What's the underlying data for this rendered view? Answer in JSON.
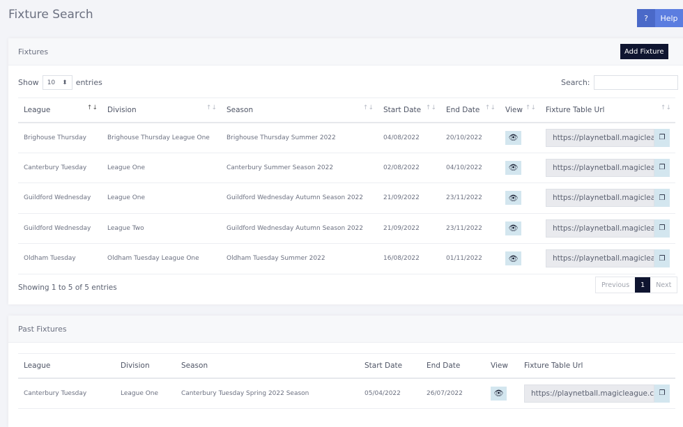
{
  "page": {
    "title": "Fixture Search",
    "help_icon": "?",
    "help_label": "Help"
  },
  "fixtures": {
    "title": "Fixtures",
    "add_label": "Add Fixture",
    "show_label": "Show",
    "entries_value": "10",
    "entries_label": "entries",
    "search_label": "Search:",
    "columns": [
      "League",
      "Division",
      "Season",
      "Start Date",
      "End Date",
      "View",
      "Fixture Table Url"
    ],
    "rows": [
      [
        "Brighouse Thursday",
        "Brighouse Thursday League One",
        "Brighouse Thursday Summer 2022",
        "04/08/2022",
        "20/10/2022",
        "https://playnetball.magicleag"
      ],
      [
        "Canterbury Tuesday",
        "League One",
        "Canterbury Summer Season 2022",
        "02/08/2022",
        "04/10/2022",
        "https://playnetball.magicleag"
      ],
      [
        "Guildford Wednesday",
        "League One",
        "Guildford Wednesday Autumn Season 2022",
        "21/09/2022",
        "23/11/2022",
        "https://playnetball.magicleag"
      ],
      [
        "Guildford Wednesday",
        "League Two",
        "Guildford Wednesday Autumn Season 2022",
        "21/09/2022",
        "23/11/2022",
        "https://playnetball.magicleag"
      ],
      [
        "Oldham Tuesday",
        "Oldham Tuesday League One",
        "Oldham Tuesday Summer 2022",
        "16/08/2022",
        "01/11/2022",
        "https://playnetball.magicleag"
      ]
    ],
    "info": "Showing 1 to 5 of 5 entries",
    "prev": "Previous",
    "page": "1",
    "next": "Next"
  },
  "past": {
    "title": "Past Fixtures",
    "columns": [
      "League",
      "Division",
      "Season",
      "Start Date",
      "End Date",
      "View",
      "Fixture Table Url"
    ],
    "rows": [
      [
        "Canterbury Tuesday",
        "League One",
        "Canterbury Tuesday Spring 2022 Season",
        "05/04/2022",
        "26/07/2022",
        "https://playnetball.magicleague.co"
      ]
    ]
  }
}
